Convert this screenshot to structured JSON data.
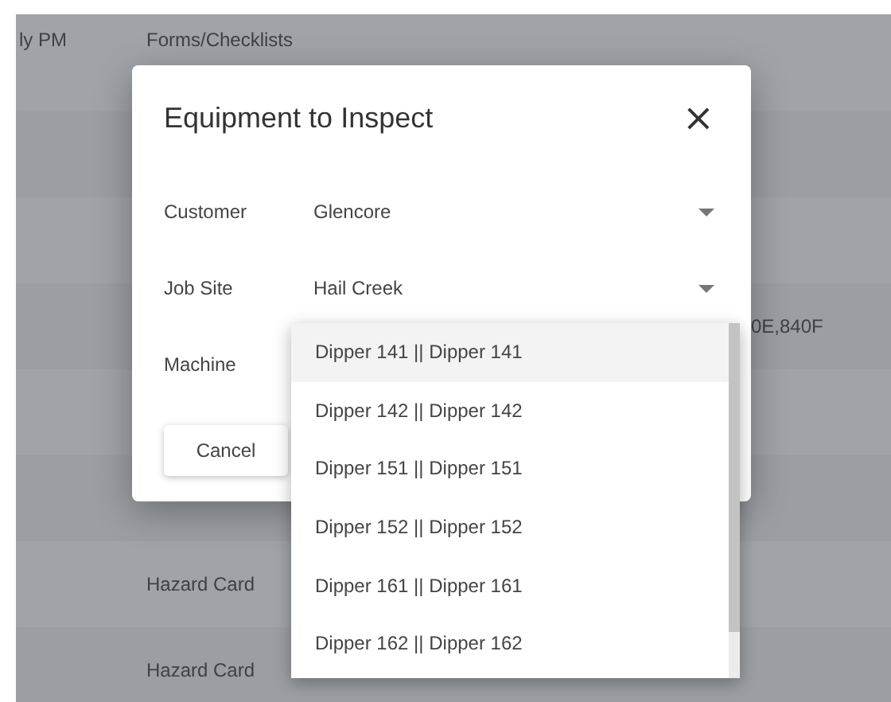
{
  "background_table": {
    "rows": [
      {
        "column_1": "ly PM",
        "column_2": "Forms/Checklists"
      },
      {},
      {},
      {
        "column_3": "0E,840F"
      },
      {},
      {},
      {
        "column_2": "Hazard Card"
      },
      {
        "column_2": "Hazard Card"
      }
    ]
  },
  "dialog": {
    "title": "Equipment to Inspect",
    "close": "×",
    "fields": [
      {
        "label": "Customer",
        "value": "Glencore",
        "kind": "select"
      },
      {
        "label": "Job Site",
        "value": "Hail Creek",
        "kind": "select"
      },
      {
        "label": "Machine",
        "kind": "open-select"
      }
    ],
    "buttons": [
      "Cancel"
    ]
  },
  "machine_menu": {
    "options": [
      {
        "label": "Dipper 141 || Dipper 141",
        "selected": true
      },
      {
        "label": "Dipper 142 || Dipper 142",
        "selected": false
      },
      {
        "label": "Dipper 151 || Dipper 151",
        "selected": false
      },
      {
        "label": "Dipper 152 || Dipper 152",
        "selected": false
      },
      {
        "label": "Dipper 161 || Dipper 161",
        "selected": false
      },
      {
        "label": "Dipper 162 || Dipper 162",
        "selected": false
      }
    ]
  }
}
